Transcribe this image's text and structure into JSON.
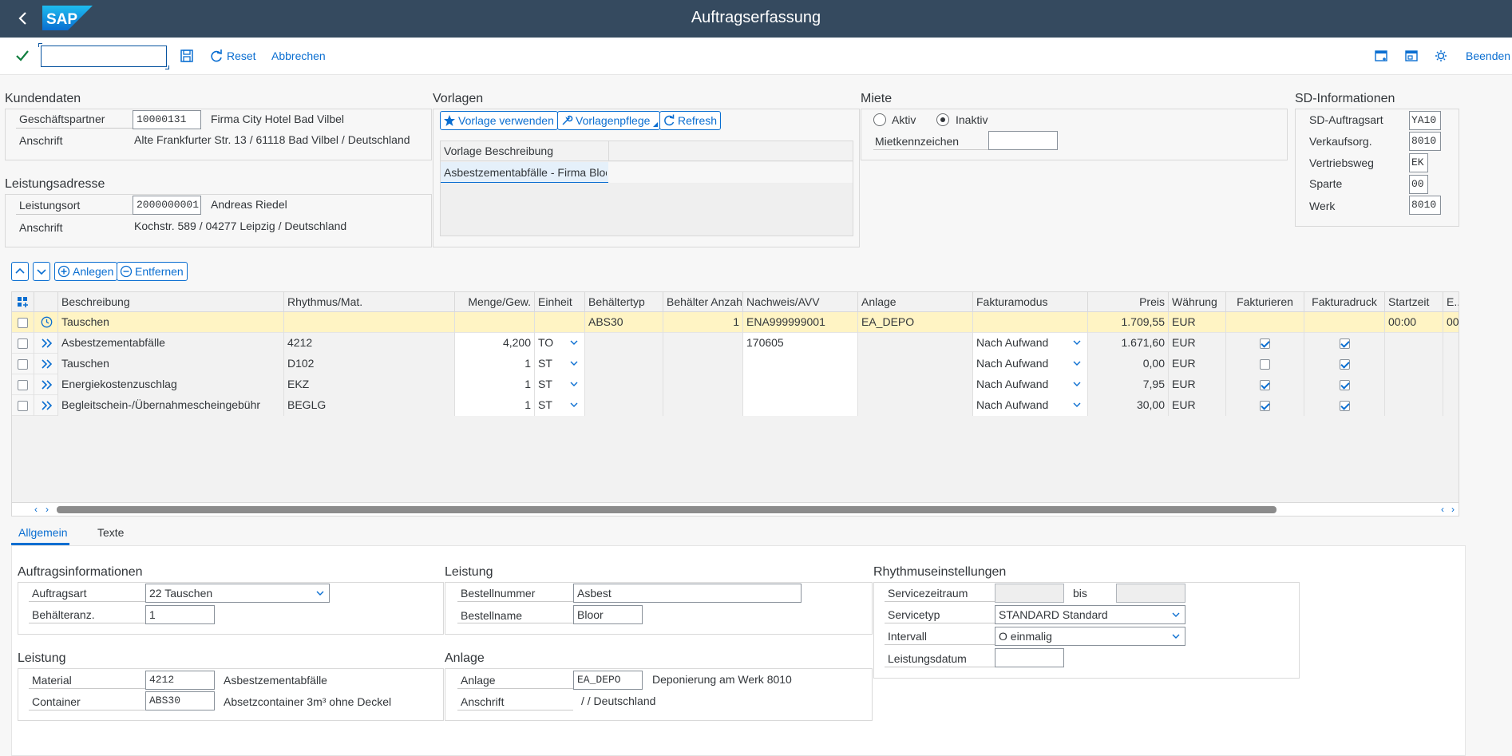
{
  "shell": {
    "title": "Auftragserfassung",
    "logo_text": "SAP"
  },
  "toolbar": {
    "command_value": "",
    "reset_label": "Reset",
    "cancel_label": "Abbrechen",
    "exit_label": "Beenden"
  },
  "kundendaten": {
    "title": "Kundendaten",
    "partner_label": "Geschäftspartner",
    "partner_value": "10000131",
    "partner_name": "Firma City Hotel Bad Vilbel",
    "address_label": "Anschrift",
    "address_value": "Alte Frankfurter Str. 13 / 61118 Bad Vilbel / Deutschland"
  },
  "leistungsadresse": {
    "title": "Leistungsadresse",
    "ort_label": "Leistungsort",
    "ort_value": "2000000001",
    "ort_name": "Andreas Riedel",
    "address_label": "Anschrift",
    "address_value": "Kochstr. 589 / 04277 Leipzig / Deutschland"
  },
  "vorlagen": {
    "title": "Vorlagen",
    "use_label": "Vorlage verwenden",
    "maint_label": "Vorlagenpflege",
    "refresh_label": "Refresh",
    "column_header": "Vorlage Beschreibung",
    "rows": [
      "Asbestzementabfälle - Firma Bloor"
    ]
  },
  "miete": {
    "title": "Miete",
    "aktiv_label": "Aktiv",
    "inaktiv_label": "Inaktiv",
    "selected": "Inaktiv",
    "kennzeichen_label": "Mietkennzeichen",
    "kennzeichen_value": ""
  },
  "sd": {
    "title": "SD-Informationen",
    "auftragsart_label": "SD-Auftragsart",
    "auftragsart_value": "YA10",
    "verkauf_label": "Verkaufsorg.",
    "verkauf_value": "8010",
    "vertrieb_label": "Vertriebsweg",
    "vertrieb_value": "EK",
    "sparte_label": "Sparte",
    "sparte_value": "00",
    "werk_label": "Werk",
    "werk_value": "8010"
  },
  "positions": {
    "anlegen_label": "Anlegen",
    "entfernen_label": "Entfernen",
    "columns": {
      "beschreibung": "Beschreibung",
      "rhythmus": "Rhythmus/Mat.",
      "menge": "Menge/Gew.",
      "einheit": "Einheit",
      "behaeltertyp": "Behältertyp",
      "anzahl": "Behälter Anzahl",
      "nachweis": "Nachweis/AVV",
      "anlage": "Anlage",
      "fakturamodus": "Fakturamodus",
      "preis": "Preis",
      "waehrung": "Währung",
      "fakturieren": "Fakturieren",
      "fakturadruck": "Fakturadruck",
      "startzeit": "Startzeit",
      "more": "E..."
    },
    "rows": [
      {
        "beschreibung": "Tauschen",
        "rhythmus": "",
        "menge": "",
        "einheit": "",
        "behaeltertyp": "ABS30",
        "anzahl": "1",
        "nachweis": "ENA999999001",
        "anlage": "EA_DEPO",
        "fakturamodus": "",
        "preis": "1.709,55",
        "waehrung": "EUR",
        "fakturieren": null,
        "fakturadruck": null,
        "startzeit": "00:00",
        "more": "00"
      },
      {
        "beschreibung": "Asbestzementabfälle",
        "rhythmus": "4212",
        "menge": "4,200",
        "einheit": "TO",
        "behaeltertyp": "",
        "anzahl": "",
        "nachweis": "170605",
        "anlage": "",
        "fakturamodus": "Nach Aufwand",
        "preis": "1.671,60",
        "waehrung": "EUR",
        "fakturieren": true,
        "fakturadruck": true,
        "startzeit": "",
        "more": ""
      },
      {
        "beschreibung": "Tauschen",
        "rhythmus": "D102",
        "menge": "1",
        "einheit": "ST",
        "behaeltertyp": "",
        "anzahl": "",
        "nachweis": "",
        "anlage": "",
        "fakturamodus": "Nach Aufwand",
        "preis": "0,00",
        "waehrung": "EUR",
        "fakturieren": false,
        "fakturadruck": true,
        "startzeit": "",
        "more": ""
      },
      {
        "beschreibung": "Energiekostenzuschlag",
        "rhythmus": "EKZ",
        "menge": "1",
        "einheit": "ST",
        "behaeltertyp": "",
        "anzahl": "",
        "nachweis": "",
        "anlage": "",
        "fakturamodus": "Nach Aufwand",
        "preis": "7,95",
        "waehrung": "EUR",
        "fakturieren": true,
        "fakturadruck": true,
        "startzeit": "",
        "more": ""
      },
      {
        "beschreibung": "Begleitschein-/Übernahmescheingebühr",
        "rhythmus": "BEGLG",
        "menge": "1",
        "einheit": "ST",
        "behaeltertyp": "",
        "anzahl": "",
        "nachweis": "",
        "anlage": "",
        "fakturamodus": "Nach Aufwand",
        "preis": "30,00",
        "waehrung": "EUR",
        "fakturieren": true,
        "fakturadruck": true,
        "startzeit": "",
        "more": ""
      }
    ]
  },
  "tabs": {
    "allgemein": "Allgemein",
    "texte": "Texte",
    "active": "Allgemein"
  },
  "auftragsinfo": {
    "title": "Auftragsinformationen",
    "art_label": "Auftragsart",
    "art_value": "22 Tauschen",
    "anz_label": "Behälteranz.",
    "anz_value": "1"
  },
  "leistung_top": {
    "title": "Leistung",
    "bestellnr_label": "Bestellnummer",
    "bestellnr_value": "Asbest",
    "bestellname_label": "Bestellname",
    "bestellname_value": "Bloor"
  },
  "rhythmus": {
    "title": "Rhythmuseinstellungen",
    "zeitraum_label": "Servicezeitraum",
    "bis_label": "bis",
    "typ_label": "Servicetyp",
    "typ_value": "STANDARD Standard",
    "intervall_label": "Intervall",
    "intervall_value": "O einmalig",
    "datum_label": "Leistungsdatum",
    "datum_value": ""
  },
  "leistung_bottom": {
    "title": "Leistung",
    "material_label": "Material",
    "material_value": "4212",
    "material_text": "Asbestzementabfälle",
    "container_label": "Container",
    "container_value": "ABS30",
    "container_text": "Absetzcontainer 3m³ ohne Deckel"
  },
  "anlage": {
    "title": "Anlage",
    "anlage_label": "Anlage",
    "anlage_value": "EA_DEPO",
    "anlage_text": "Deponierung am Werk 8010",
    "anschrift_label": "Anschrift",
    "anschrift_value": "/ / Deutschland"
  },
  "colors": {
    "shell": "#354a5f",
    "accent": "#0a6ed1",
    "highlight_row": "#fff4c4",
    "ok_green": "#107e3e"
  }
}
